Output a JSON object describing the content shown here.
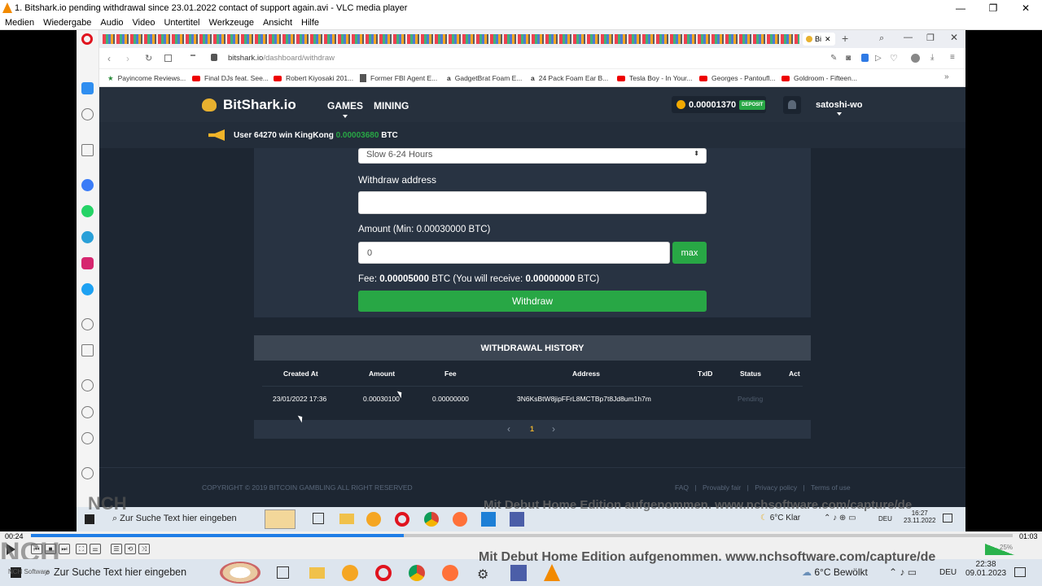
{
  "vlc": {
    "title": "1. Bitshark.io pending withdrawal since 23.01.2022 contact of support again.avi - VLC media player",
    "menu": [
      "Medien",
      "Wiedergabe",
      "Audio",
      "Video",
      "Untertitel",
      "Werkzeuge",
      "Ansicht",
      "Hilfe"
    ],
    "time_elapsed": "00:24",
    "time_total": "01:03",
    "volume": "25%",
    "progress_fraction": 0.38
  },
  "browser": {
    "active_tab": "Bi",
    "url_host": "bitshark.io",
    "url_path": "/dashboard/withdraw",
    "vpn_label": "VPN",
    "bookmarks": [
      "Payincome Reviews...",
      "Final DJs feat. See...",
      "Robert Kiyosaki 201...",
      "Former FBI Agent E...",
      "GadgetBrat Foam E...",
      "24 Pack Foam Ear B...",
      "Tesla Boy - In Your...",
      "Georges - Pantoufl...",
      "Goldroom - Fifteen..."
    ]
  },
  "site": {
    "logo": "BitShark.io",
    "nav": {
      "games": "GAMES",
      "mining": "MINING"
    },
    "balance": "0.00001370",
    "deposit": "DEPOSIT",
    "username": "satoshi-wo",
    "ticker": {
      "prefix": "User 64270 win KingKong",
      "amount": "0.00003680",
      "unit": "BTC"
    },
    "form": {
      "speed_value": "Slow 6-24 Hours",
      "address_label": "Withdraw address",
      "address_value": "",
      "amount_label": "Amount (Min: 0.00030000 BTC)",
      "amount_value": "0",
      "max_label": "max",
      "fee_prefix": "Fee:",
      "fee_value": "0.00005000",
      "fee_mid": "BTC (You will receive:",
      "receive_value": "0.00000000",
      "fee_suffix": "BTC)",
      "withdraw_label": "Withdraw"
    },
    "history": {
      "title": "WITHDRAWAL HISTORY",
      "columns": [
        "Created At",
        "Amount",
        "Fee",
        "Address",
        "TxID",
        "Status",
        "Act"
      ],
      "rows": [
        [
          "23/01/2022 17:36",
          "0.00030100",
          "0.00000000",
          "3N6KsBtW8jipFFrL8MCTBp7t8Jd8um1h7m",
          "",
          "Pending",
          ""
        ]
      ],
      "pager": {
        "prev": "‹",
        "current": "1",
        "next": "›"
      }
    },
    "footer": {
      "copyright": "COPYRIGHT © 2019 BITCOIN GAMBLING ALL RIGHT RESERVED",
      "links": [
        "FAQ",
        "|",
        "Provably fair",
        "|",
        "Privacy policy",
        "|",
        "Terms of use"
      ]
    }
  },
  "inner_taskbar": {
    "search_placeholder": "Zur Suche Text hier eingeben",
    "weather": "6°C Klar",
    "lang": "DEU",
    "time": "16:27",
    "date": "23.11.2022"
  },
  "outer_taskbar": {
    "search_placeholder": "Zur Suche Text hier eingeben",
    "weather": "6°C Bewölkt",
    "lang": "DEU",
    "time": "22:38",
    "date": "09.01.2023"
  },
  "watermark": {
    "text": "Mit Debut Home Edition aufgenommen. www.nchsoftware.com/capture/de",
    "logo": "NCH",
    "logo_sub": "NCH Software"
  },
  "colors": {
    "site_bg": "#1d2632",
    "accent_green": "#28a745",
    "seek_blue": "#1f7de6"
  }
}
